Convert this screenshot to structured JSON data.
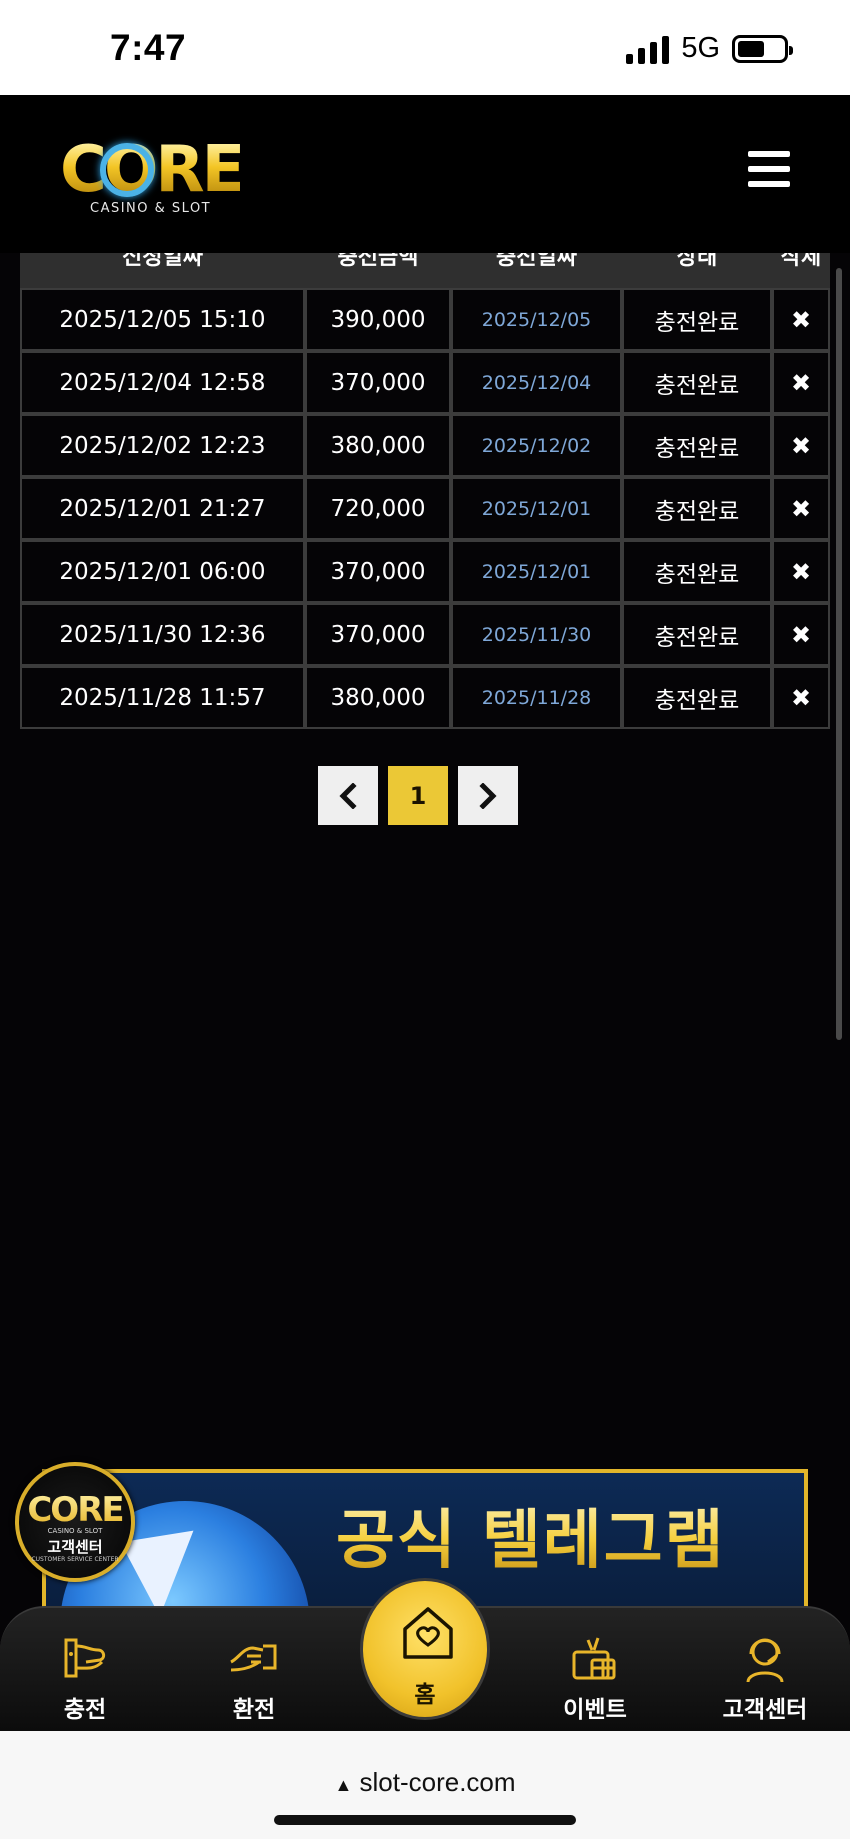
{
  "status_bar": {
    "time": "7:47",
    "network": "5G",
    "battery_level": 0.6
  },
  "header": {
    "logo_text": "CORE",
    "logo_subtitle": "CASINO & SLOT",
    "menu_icon": "hamburger-icon"
  },
  "table": {
    "columns": [
      "신청일짜",
      "충전금액",
      "충전일짜",
      "상태",
      "삭제"
    ],
    "rows": [
      {
        "request_date": "2025/12/05 15:10",
        "amount": "390,000",
        "charge_date": "2025/12/05",
        "status": "충전완료",
        "delete": "✖"
      },
      {
        "request_date": "2025/12/04 12:58",
        "amount": "370,000",
        "charge_date": "2025/12/04",
        "status": "충전완료",
        "delete": "✖"
      },
      {
        "request_date": "2025/12/02 12:23",
        "amount": "380,000",
        "charge_date": "2025/12/02",
        "status": "충전완료",
        "delete": "✖"
      },
      {
        "request_date": "2025/12/01 21:27",
        "amount": "720,000",
        "charge_date": "2025/12/01",
        "status": "충전완료",
        "delete": "✖"
      },
      {
        "request_date": "2025/12/01 06:00",
        "amount": "370,000",
        "charge_date": "2025/12/01",
        "status": "충전완료",
        "delete": "✖"
      },
      {
        "request_date": "2025/11/30 12:36",
        "amount": "370,000",
        "charge_date": "2025/11/30",
        "status": "충전완료",
        "delete": "✖"
      },
      {
        "request_date": "2025/11/28 11:57",
        "amount": "380,000",
        "charge_date": "2025/11/28",
        "status": "충전완료",
        "delete": "✖"
      }
    ]
  },
  "pagination": {
    "prev": "‹",
    "current_page": "1",
    "next": "›"
  },
  "banner": {
    "title": "공식 텔레그램"
  },
  "cs_badge": {
    "logo": "CORE",
    "subtitle": "CASINO & SLOT",
    "label": "고객센터",
    "tag": "CUSTOMER SERVICE CENTER"
  },
  "bottom_nav": {
    "deposit": "충전",
    "withdraw": "환전",
    "home": "홈",
    "event": "이벤트",
    "support": "고객센터"
  },
  "browser": {
    "url": "slot-core.com"
  },
  "colors": {
    "accent_gold": "#ebc836",
    "charge_date_blue": "#7fa8d8",
    "background": "#050406"
  }
}
